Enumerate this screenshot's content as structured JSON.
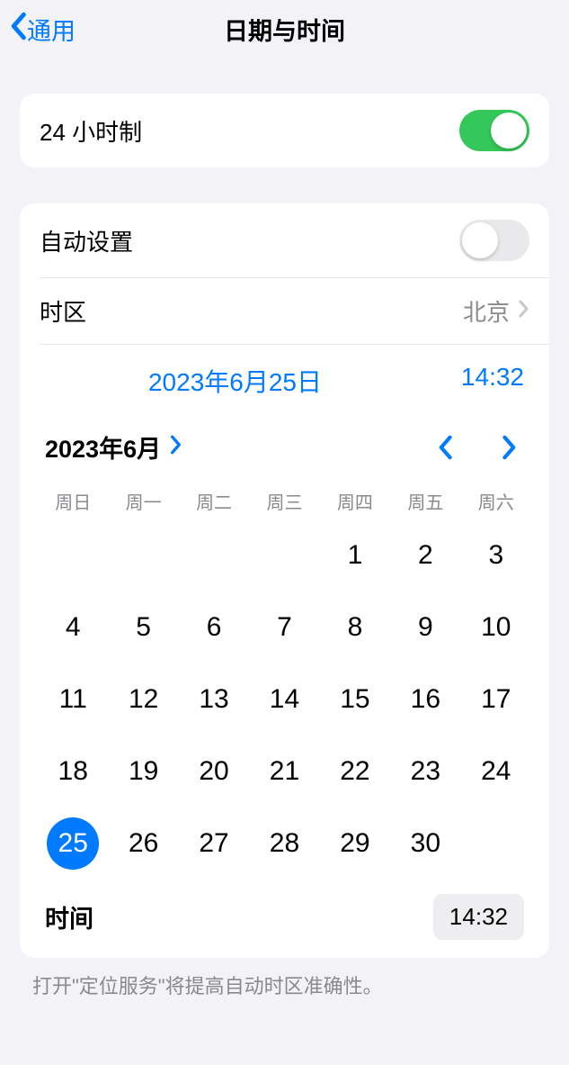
{
  "nav": {
    "back": "通用",
    "title": "日期与时间"
  },
  "twentyFourHour": {
    "label": "24 小时制",
    "on": true
  },
  "auto": {
    "label": "自动设置",
    "on": false
  },
  "timezone": {
    "label": "时区",
    "value": "北京"
  },
  "summary": {
    "date": "2023年6月25日",
    "time": "14:32"
  },
  "calendar": {
    "monthLabel": "2023年6月",
    "weekdays": [
      "周日",
      "周一",
      "周二",
      "周三",
      "周四",
      "周五",
      "周六"
    ],
    "firstWeekdayIndex": 4,
    "daysInMonth": 30,
    "selectedDay": 25
  },
  "timeRow": {
    "label": "时间",
    "value": "14:32"
  },
  "footer": "打开\"定位服务\"将提高自动时区准确性。"
}
